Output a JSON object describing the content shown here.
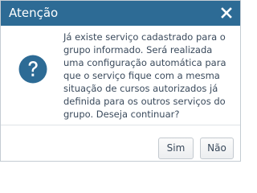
{
  "dialog": {
    "title": "Atenção",
    "close_icon": "close-icon",
    "message": "Já existe serviço cadastrado para o grupo informado. Será realizada uma configuração automática para que o serviço fique com a mesma situação de cursos autorizados já definida para os outros serviços do grupo. Deseja continuar?",
    "icon": "question-icon",
    "buttons": {
      "yes_label": "Sim",
      "no_label": "Não"
    }
  },
  "colors": {
    "titlebar": "#2d6b95",
    "title_text": "#ffffff",
    "icon_fill": "#2d6b95",
    "text": "#3a4a5c"
  }
}
